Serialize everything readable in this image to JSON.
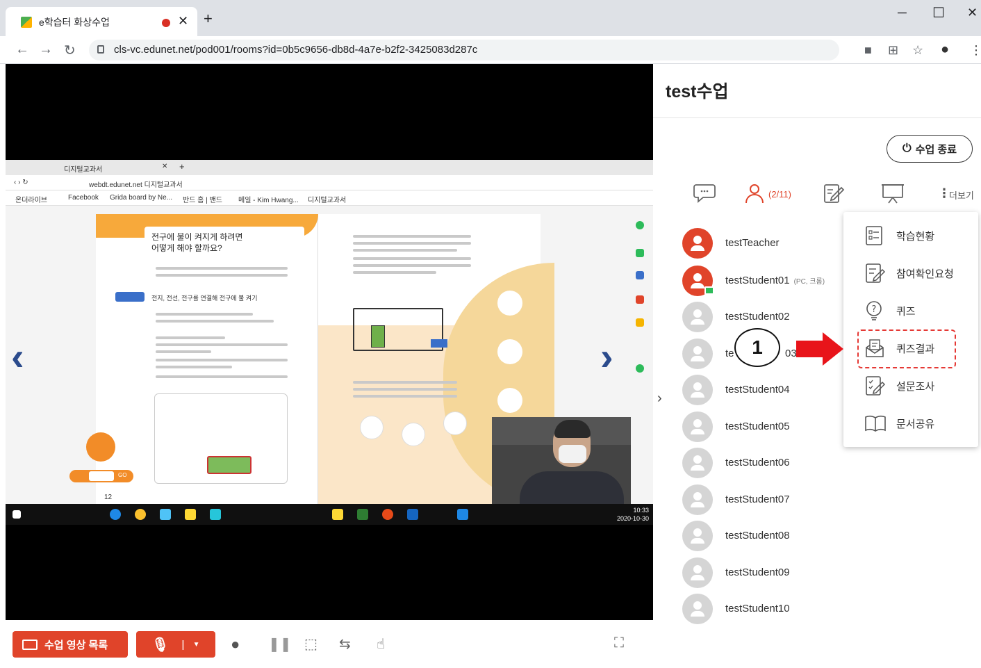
{
  "browser": {
    "tab_title": "e학습터 화상수업",
    "url": "cls-vc.edunet.net/pod001/rooms?id=0b5c9656-db8d-4a7e-b2f2-3425083d287c"
  },
  "shared_screen": {
    "inner_tab_title": "디지털교과서",
    "inner_url": "webdt.edunet.net 디지털교과서",
    "bookmarks": [
      "온더라이브",
      "Facebook",
      "Grida board by Ne...",
      "반드 홈 | 밴드",
      "메일 - Kim Hwang...",
      "디지털교과서"
    ],
    "book_heading_line1": "전구에 불이 켜지게 하려면",
    "book_heading_line2": "어떻게 해야 할까요?",
    "book_subheading": "전지, 전선, 전구를 연결해 전구에 불 켜기",
    "page_number": "12",
    "go_label": "GO",
    "clock_time": "10:33",
    "clock_date": "2020-10-30"
  },
  "controls": {
    "video_list_label": "수업 영상 목록"
  },
  "panel": {
    "class_title": "test수업",
    "end_button_label": "수업 종료",
    "participants_count": "(2/11)",
    "more_label": "더보기",
    "users": [
      {
        "name": "testTeacher",
        "device": "",
        "status": "active"
      },
      {
        "name": "testStudent01",
        "device": "(PC, 크롬)",
        "status": "active"
      },
      {
        "name": "testStudent02",
        "device": "",
        "status": "offline"
      },
      {
        "name": "te",
        "device": "",
        "status": "offline",
        "suffix": "03"
      },
      {
        "name": "testStudent04",
        "device": "",
        "status": "offline"
      },
      {
        "name": "testStudent05",
        "device": "",
        "status": "offline"
      },
      {
        "name": "testStudent06",
        "device": "",
        "status": "offline"
      },
      {
        "name": "testStudent07",
        "device": "",
        "status": "offline"
      },
      {
        "name": "testStudent08",
        "device": "",
        "status": "offline"
      },
      {
        "name": "testStudent09",
        "device": "",
        "status": "offline"
      },
      {
        "name": "testStudent10",
        "device": "",
        "status": "offline"
      }
    ],
    "menu": [
      {
        "label": "학습현황",
        "icon": "report-icon"
      },
      {
        "label": "참여확인요청",
        "icon": "check-request-icon"
      },
      {
        "label": "퀴즈",
        "icon": "quiz-icon"
      },
      {
        "label": "퀴즈결과",
        "icon": "quiz-result-icon"
      },
      {
        "label": "설문조사",
        "icon": "survey-icon"
      },
      {
        "label": "문서공유",
        "icon": "book-share-icon"
      }
    ]
  },
  "annotation": {
    "step_number": "1"
  },
  "colors": {
    "accent": "#e0442a",
    "highlight": "#e53935",
    "nav_arrow": "#2b4b8c"
  }
}
